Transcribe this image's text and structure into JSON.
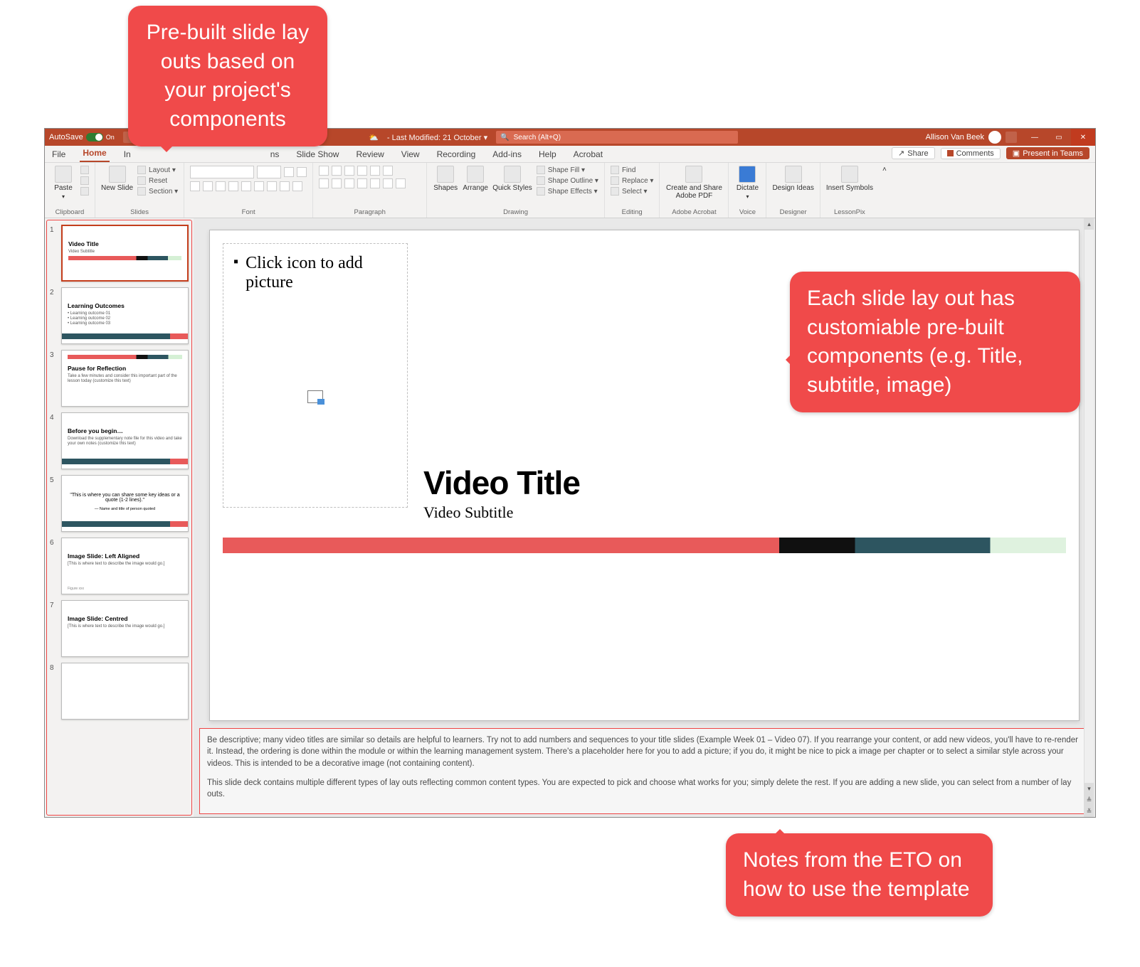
{
  "callouts": {
    "c1": "Pre-built slide lay outs based on your project's components",
    "c2": "Each slide lay out has customiable pre-built components (e.g. Title, subtitle, image)",
    "c3": "Notes from the ETO on how to use the template"
  },
  "titlebar": {
    "autosave": "AutoSave",
    "autosave_state": "On",
    "modified": "- Last Modified: 21 October ▾",
    "search_placeholder": "Search (Alt+Q)",
    "user": "Allison Van Beek"
  },
  "tabs": {
    "items": [
      "File",
      "Home",
      "In",
      "",
      "",
      "ns",
      "Slide Show",
      "Review",
      "View",
      "Recording",
      "Add-ins",
      "Help",
      "Acrobat"
    ],
    "active_index": 1,
    "share": "Share",
    "comments": "Comments",
    "present": "Present in Teams"
  },
  "ribbon": {
    "clipboard": {
      "paste": "Paste",
      "label": "Clipboard"
    },
    "slides": {
      "newslide": "New Slide",
      "layout": "Layout ▾",
      "reset": "Reset",
      "section": "Section ▾",
      "label": "Slides"
    },
    "font": {
      "label": "Font"
    },
    "paragraph": {
      "label": "Paragraph"
    },
    "drawing": {
      "shapes": "Shapes",
      "arrange": "Arrange",
      "quick": "Quick Styles",
      "sfill": "Shape Fill ▾",
      "soutline": "Shape Outline ▾",
      "seffects": "Shape Effects ▾",
      "label": "Drawing"
    },
    "editing": {
      "find": "Find",
      "replace": "Replace ▾",
      "select": "Select ▾",
      "label": "Editing"
    },
    "acrobat": {
      "btn": "Create and Share Adobe PDF",
      "label": "Adobe Acrobat"
    },
    "voice": {
      "btn": "Dictate",
      "label": "Voice"
    },
    "designer": {
      "btn": "Design Ideas",
      "label": "Designer"
    },
    "lessonpix": {
      "btn": "Insert Symbols",
      "label": "LessonPix"
    }
  },
  "thumbs": [
    {
      "n": "1",
      "title": "Video Title",
      "sub": "Video Subtitle",
      "bar": "top",
      "active": true
    },
    {
      "n": "2",
      "title": "Learning Outcomes",
      "body": "• Learning outcome 01\n• Learning outcome 02\n• Learning outcome 03",
      "bar": "bottom"
    },
    {
      "n": "3",
      "title": "Pause for Reflection",
      "body": "Take a few minutes and consider this important part of the lesson today (customize this text)",
      "topstrip": true
    },
    {
      "n": "4",
      "title": "Before you begin…",
      "body": "Download the supplementary note file for this video and take your own notes (customize this text)",
      "bar": "bottom"
    },
    {
      "n": "5",
      "quote": "\"This is where you can share some key ideas or a quote (1-2 lines).\"",
      "attrib": "— Name and title of person quoted",
      "bar": "bottom"
    },
    {
      "n": "6",
      "title": "Image Slide: Left Aligned",
      "body": "[This is where text to describe the image would go.]",
      "footer": "Figure xxx"
    },
    {
      "n": "7",
      "title": "Image Slide: Centred",
      "body": "[This is where text to describe the image would go.]"
    },
    {
      "n": "8",
      "title": ""
    }
  ],
  "slide": {
    "picprompt": "Click icon to add picture",
    "title": "Video Title",
    "subtitle": "Video Subtitle"
  },
  "notes": {
    "p1": "Be descriptive; many video titles are similar so details are helpful to learners. Try not to add numbers and sequences to your title slides (Example Week 01 – Video 07). If you rearrange your content, or add new videos, you'll have to re-render it. Instead, the ordering is done within the module or within the learning management system. There's a placeholder here for you to add a picture; if you do, it might be nice to pick a image per chapter or to select a similar style across your videos. This is intended to be a decorative image (not containing content).",
    "p2": "This slide deck contains multiple different types of lay outs reflecting common content types. You are expected to pick and choose what works for you; simply delete the rest. If you are adding a new slide, you can select from a number of lay outs."
  }
}
